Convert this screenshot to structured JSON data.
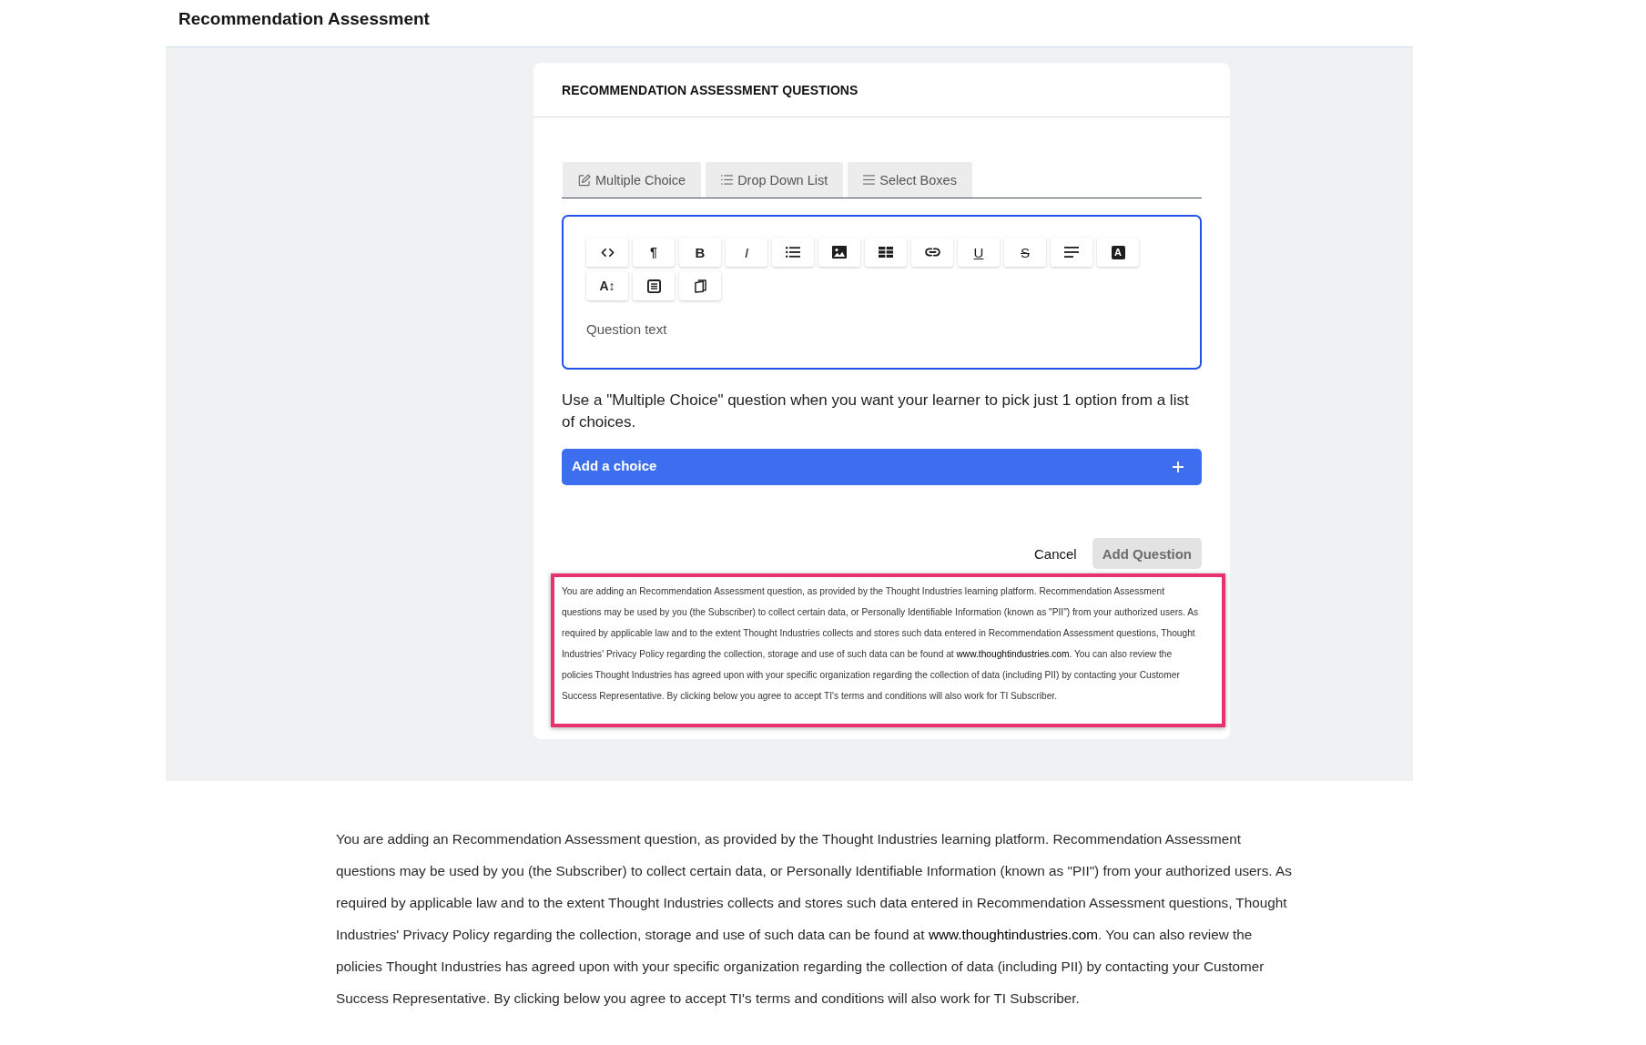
{
  "page": {
    "title": "Recommendation Assessment"
  },
  "card": {
    "title": "RECOMMENDATION ASSESSMENT QUESTIONS"
  },
  "tabs": [
    {
      "label": "Multiple Choice"
    },
    {
      "label": "Drop Down List"
    },
    {
      "label": "Select Boxes"
    }
  ],
  "editor": {
    "toolbar": [
      {
        "kind": "icon"
      },
      {
        "kind": "plain",
        "label": "¶"
      },
      {
        "kind": "bold",
        "label": "B"
      },
      {
        "kind": "italic",
        "label": "I"
      },
      {
        "kind": "icon"
      },
      {
        "kind": "icon"
      },
      {
        "kind": "icon"
      },
      {
        "kind": "icon"
      },
      {
        "kind": "underline",
        "label": "U"
      },
      {
        "kind": "strike",
        "label": "S"
      },
      {
        "kind": "icon"
      },
      {
        "kind": "inverse",
        "label": "A"
      },
      {
        "kind": "plain",
        "label": "A↕"
      },
      {
        "kind": "icon"
      },
      {
        "kind": "icon"
      }
    ],
    "placeholder": "Question text"
  },
  "hint": "Use a \"Multiple Choice\" question when you want your learner to pick just 1 option from a list of choices.",
  "add_choice": {
    "label": "Add a choice"
  },
  "actions": {
    "cancel": "Cancel",
    "submit": {
      "label": "Add Question",
      "disabled": true
    }
  },
  "disclaimer": {
    "text_before": "You are adding an Recommendation Assessment question, as provided by the Thought Industries learning platform. Recommendation Assessment questions may be used by you (the Subscriber) to collect certain data, or Personally Identifiable Information (known as \"PII\") from your authorized users. As required by applicable law and to the extent Thought Industries collects and stores such data entered in Recommendation Assessment questions, Thought Industries' Privacy Policy regarding the collection, storage and use of such data can be found at ",
    "link": "www.thoughtindustries.com",
    "text_after": ". You can also review the policies Thought Industries has agreed upon with your specific organization regarding the collection of data (including PII) by contacting your Customer Success Representative. By clicking below you agree to accept TI's terms and conditions will also work for TI Subscriber."
  },
  "notice": {
    "text_before": "You are adding an Recommendation Assessment question, as provided by the Thought Industries learning platform. Recommendation Assessment questions may be used by you (the Subscriber) to collect certain data, or Personally Identifiable Information (known as \"PII\") from your authorized users. As required by applicable law and to the extent Thought Industries collects and stores such data entered in Recommendation Assessment questions, Thought Industries' Privacy Policy regarding the collection, storage and use of such data can be found at ",
    "link": "www.thoughtindustries.com",
    "text_after": ". You can also review the policies Thought Industries has agreed upon with your specific organization regarding the collection of data (including PII) by contacting your Customer Success Representative. By clicking below you agree to accept TI's terms and conditions will also work for TI Subscriber."
  }
}
